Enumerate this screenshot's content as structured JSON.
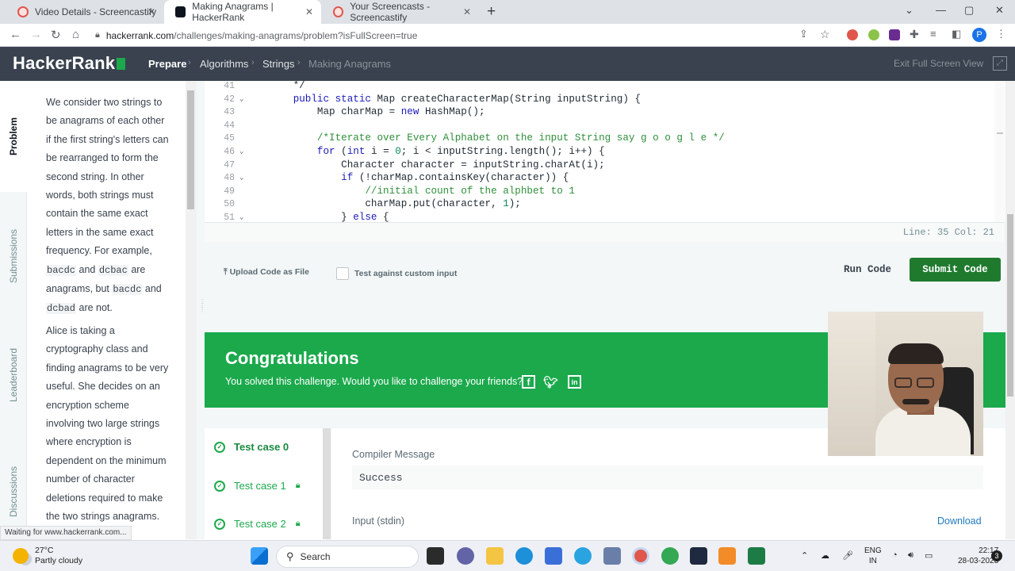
{
  "browser": {
    "tabs": [
      {
        "title": "Video Details - Screencastify",
        "active": false
      },
      {
        "title": "Making Anagrams | HackerRank",
        "active": true
      },
      {
        "title": "Your Screencasts - Screencastify",
        "active": false
      }
    ],
    "url_host": "hackerrank.com",
    "url_path": "/challenges/making-anagrams/problem?isFullScreen=true",
    "profile_initial": "P"
  },
  "header": {
    "logo": "HackerRank",
    "breadcrumbs": [
      "Prepare",
      "Algorithms",
      "Strings",
      "Making Anagrams"
    ],
    "exit_label": "Exit Full Screen View"
  },
  "side_tabs": [
    "Problem",
    "Submissions",
    "Leaderboard",
    "Discussions"
  ],
  "problem": {
    "p1_a": "We consider two strings to be anagrams of each other if the first string's letters can be rearranged to form the second string. In other words, both strings must contain the same exact letters in the same exact frequency. For example, ",
    "code1": "bacdc",
    "and1": " and ",
    "code2": "dcbac",
    "are1": " are anagrams, but ",
    "code3": "bacdc",
    "and2": " and ",
    "code4": "dcbad",
    "are2": " are not.",
    "p2": "Alice is taking a cryptography class and finding anagrams to be very useful. She decides on an encryption scheme involving two large strings where encryption is dependent on the minimum number of character deletions required to make the two strings anagrams. Can you"
  },
  "editor": {
    "lines": [
      {
        "n": "41",
        "fold": false,
        "html": "   */"
      },
      {
        "n": "42",
        "fold": true,
        "html": "   <span class=\"kw\">public static</span> Map createCharacterMap(String inputString) {"
      },
      {
        "n": "43",
        "fold": false,
        "html": "       Map charMap = <span class=\"kw\">new</span> HashMap();"
      },
      {
        "n": "44",
        "fold": false,
        "html": ""
      },
      {
        "n": "45",
        "fold": false,
        "html": "       <span class=\"cm\">/*Iterate over Every Alphabet on the input String say g o o g l e */</span>"
      },
      {
        "n": "46",
        "fold": true,
        "html": "       <span class=\"kw\">for</span> (<span class=\"kw\">int</span> i = <span class=\"num\">0</span>; i &lt; inputString.length(); i++) {"
      },
      {
        "n": "47",
        "fold": false,
        "html": "           Character character = inputString.charAt(i);"
      },
      {
        "n": "48",
        "fold": true,
        "html": "           <span class=\"kw\">if</span> (!charMap.containsKey(character)) {"
      },
      {
        "n": "49",
        "fold": false,
        "html": "               <span class=\"cm\">//initial count of the alphbet to 1</span>"
      },
      {
        "n": "50",
        "fold": false,
        "html": "               charMap.put(character, <span class=\"num\">1</span>);"
      },
      {
        "n": "51",
        "fold": true,
        "html": "           } <span class=\"kw\">else</span> {"
      }
    ],
    "line_col": "Line: 35 Col: 21"
  },
  "actions": {
    "upload": "Upload Code as File",
    "custom_input": "Test against custom input",
    "run": "Run Code",
    "submit": "Submit Code"
  },
  "congrats": {
    "title": "Congratulations",
    "message": "You solved this challenge. Would you like to challenge your friends?"
  },
  "testcases": [
    {
      "label": "Test case 0",
      "locked": false
    },
    {
      "label": "Test case 1",
      "locked": true
    },
    {
      "label": "Test case 2",
      "locked": true
    }
  ],
  "output": {
    "compiler_label": "Compiler Message",
    "compiler_value": "Success",
    "input_label": "Input (stdin)",
    "download": "Download"
  },
  "status_message": "Waiting for www.hackerrank.com...",
  "taskbar": {
    "temp": "27°C",
    "weather": "Partly cloudy",
    "search": "Search",
    "lang1": "ENG",
    "lang2": "IN",
    "time": "22:17",
    "date": "28-03-2023",
    "notifications": "3"
  },
  "colors": {
    "brand_green": "#1ba94c",
    "submit_green": "#1f7a2e",
    "header_bg": "#39424e"
  }
}
